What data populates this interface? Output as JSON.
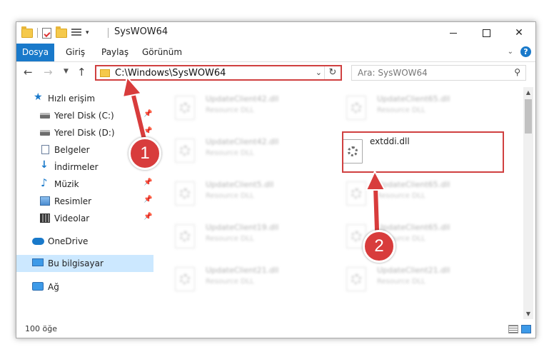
{
  "window": {
    "title": "SysWOW64",
    "icons": {
      "folder": "folder-icon",
      "properties": "properties-icon",
      "new_folder": "new-folder-icon",
      "view": "view-icon"
    },
    "controls": {
      "minimize": "minimize-icon",
      "maximize": "maximize-icon",
      "close": "✕"
    }
  },
  "ribbon": {
    "tabs": [
      "Dosya",
      "Giriş",
      "Paylaş",
      "Görünüm"
    ],
    "help": "?"
  },
  "address_bar": {
    "path": "C:\\Windows\\SysWOW64",
    "refresh": "↻",
    "dropdown": "⌄"
  },
  "search": {
    "placeholder": "Ara: SysWOW64",
    "icon": "⚲"
  },
  "nav": {
    "back": "←",
    "forward": "→",
    "up": "↑"
  },
  "sidebar": {
    "items": [
      {
        "label": "Hızlı erişim",
        "icon": "star-icon",
        "pinned": false
      },
      {
        "label": "Yerel Disk (C:)",
        "icon": "disk-icon",
        "pinned": true
      },
      {
        "label": "Yerel Disk (D:)",
        "icon": "disk-icon",
        "pinned": true
      },
      {
        "label": "Belgeler",
        "icon": "document-icon",
        "pinned": true
      },
      {
        "label": "İndirmeler",
        "icon": "download-icon",
        "pinned": true
      },
      {
        "label": "Müzik",
        "icon": "music-icon",
        "pinned": true
      },
      {
        "label": "Resimler",
        "icon": "pictures-icon",
        "pinned": true
      },
      {
        "label": "Videolar",
        "icon": "videos-icon",
        "pinned": true
      },
      {
        "label": "OneDrive",
        "icon": "onedrive-icon",
        "pinned": false
      },
      {
        "label": "Bu bilgisayar",
        "icon": "computer-icon",
        "pinned": false,
        "selected": true
      },
      {
        "label": "Ağ",
        "icon": "network-icon",
        "pinned": false
      }
    ]
  },
  "files": [
    {
      "name": "UpdateClient42.dll",
      "type": "Resource DLL"
    },
    {
      "name": "UpdateClient65.dll",
      "type": "Resource DLL"
    },
    {
      "name": "UpdateClient42.dll",
      "type": "Resource DLL"
    },
    {
      "name": "extddi.dll",
      "type": ""
    },
    {
      "name": "UpdateClient5.dll",
      "type": "Resource DLL"
    },
    {
      "name": "UpdateClient65.dll",
      "type": "Resource DLL"
    },
    {
      "name": "UpdateClient19.dll",
      "type": "Resource DLL"
    },
    {
      "name": "UpdateClient65.dll",
      "type": "Resource DLL"
    },
    {
      "name": "UpdateClient21.dll",
      "type": "Resource DLL"
    },
    {
      "name": "UpdateClient21.dll",
      "type": "Resource DLL"
    }
  ],
  "status": {
    "item_count": "100 öğe"
  },
  "annotations": {
    "step1": "1",
    "step2": "2",
    "color": "#d83c3c"
  }
}
